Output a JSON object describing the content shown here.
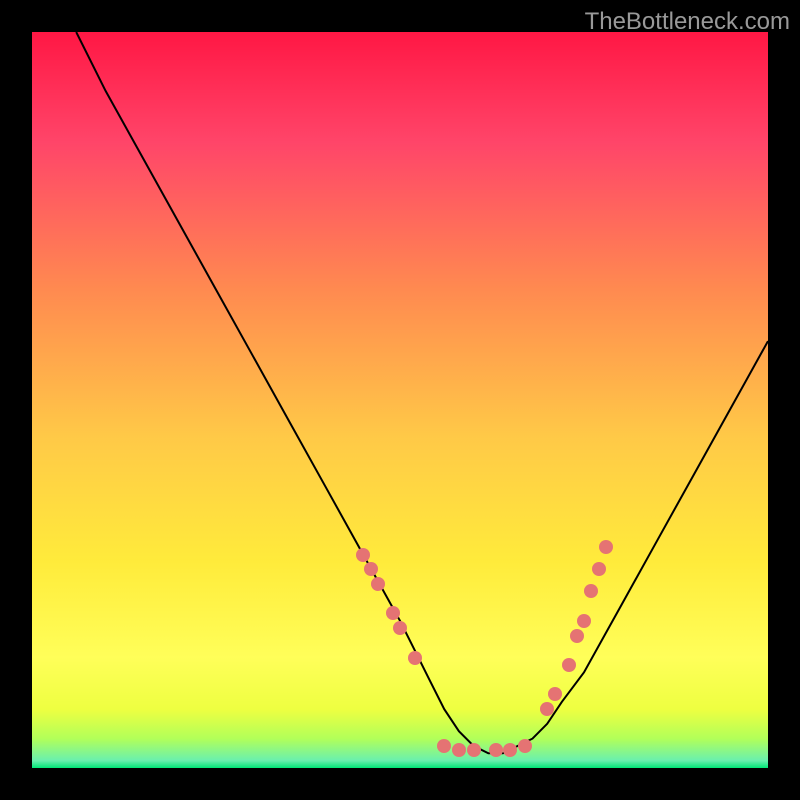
{
  "watermark": "TheBottleneck.com",
  "colors": {
    "marker": "#e57373",
    "curve": "#000000",
    "gradient_top": "#ff1744",
    "gradient_mid1": "#ff5252",
    "gradient_mid2": "#ffab40",
    "gradient_mid3": "#ffd740",
    "gradient_mid4": "#ffff00",
    "gradient_mid5": "#eeff41",
    "gradient_bottom": "#00e676"
  },
  "chart_data": {
    "type": "line",
    "title": "",
    "xlabel": "",
    "ylabel": "",
    "xlim": [
      0,
      100
    ],
    "ylim": [
      0,
      100
    ],
    "series": [
      {
        "name": "curve",
        "x": [
          6,
          10,
          15,
          20,
          25,
          30,
          35,
          40,
          45,
          50,
          52,
          54,
          56,
          58,
          60,
          62,
          64,
          66,
          68,
          70,
          72,
          75,
          80,
          85,
          90,
          95,
          100
        ],
        "y": [
          100,
          92,
          83,
          74,
          65,
          56,
          47,
          38,
          29,
          20,
          16,
          12,
          8,
          5,
          3,
          2,
          2,
          3,
          4,
          6,
          9,
          13,
          22,
          31,
          40,
          49,
          58
        ]
      }
    ],
    "markers": [
      {
        "x": 45,
        "y": 29
      },
      {
        "x": 46,
        "y": 27
      },
      {
        "x": 47,
        "y": 25
      },
      {
        "x": 49,
        "y": 21
      },
      {
        "x": 50,
        "y": 19
      },
      {
        "x": 52,
        "y": 15
      },
      {
        "x": 56,
        "y": 3
      },
      {
        "x": 58,
        "y": 2.5
      },
      {
        "x": 60,
        "y": 2.5
      },
      {
        "x": 63,
        "y": 2.5
      },
      {
        "x": 65,
        "y": 2.5
      },
      {
        "x": 67,
        "y": 3
      },
      {
        "x": 70,
        "y": 8
      },
      {
        "x": 71,
        "y": 10
      },
      {
        "x": 73,
        "y": 14
      },
      {
        "x": 74,
        "y": 18
      },
      {
        "x": 75,
        "y": 20
      },
      {
        "x": 76,
        "y": 24
      },
      {
        "x": 77,
        "y": 27
      },
      {
        "x": 78,
        "y": 30
      }
    ],
    "gradient_stops": [
      {
        "offset": 0,
        "color": "#ff1744"
      },
      {
        "offset": 0.15,
        "color": "#ff4569"
      },
      {
        "offset": 0.35,
        "color": "#ff8a50"
      },
      {
        "offset": 0.55,
        "color": "#ffc947"
      },
      {
        "offset": 0.72,
        "color": "#ffeb3b"
      },
      {
        "offset": 0.85,
        "color": "#ffff59"
      },
      {
        "offset": 0.92,
        "color": "#eeff41"
      },
      {
        "offset": 0.96,
        "color": "#b2ff59"
      },
      {
        "offset": 0.99,
        "color": "#69f0ae"
      },
      {
        "offset": 1.0,
        "color": "#00e676"
      }
    ]
  }
}
